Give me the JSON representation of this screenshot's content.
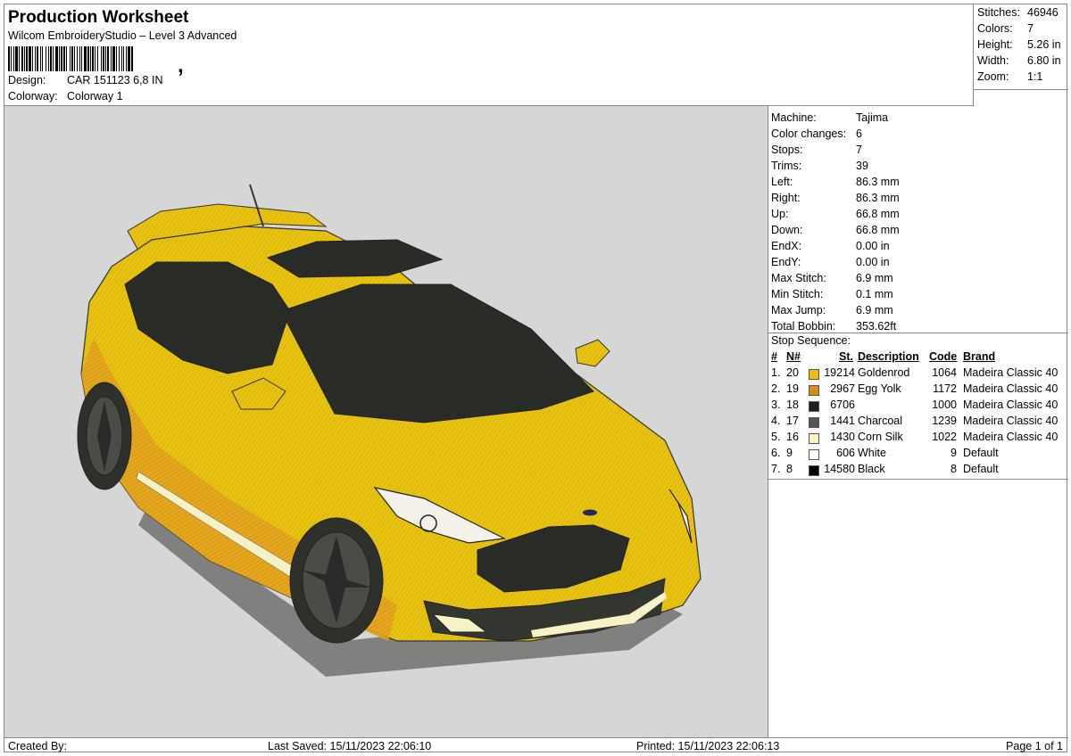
{
  "header": {
    "title": "Production Worksheet",
    "subtitle": "Wilcom EmbroideryStudio – Level 3 Advanced",
    "barcode_comma": ",",
    "design_label": "Design:",
    "design_value": "CAR 151123 6,8 IN",
    "colorway_label": "Colorway:",
    "colorway_value": "Colorway 1"
  },
  "stats": {
    "stitches_label": "Stitches:",
    "stitches_value": "46946",
    "colors_label": "Colors:",
    "colors_value": "7",
    "height_label": "Height:",
    "height_value": "5.26 in",
    "width_label": "Width:",
    "width_value": "6.80 in",
    "zoom_label": "Zoom:",
    "zoom_value": "1:1"
  },
  "machine_info": [
    {
      "label": "Machine:",
      "value": "Tajima"
    },
    {
      "label": "Color changes:",
      "value": "6"
    },
    {
      "label": "Stops:",
      "value": "7"
    },
    {
      "label": "Trims:",
      "value": "39"
    },
    {
      "label": "Left:",
      "value": "86.3 mm"
    },
    {
      "label": "Right:",
      "value": "86.3 mm"
    },
    {
      "label": "Up:",
      "value": "66.8 mm"
    },
    {
      "label": "Down:",
      "value": "66.8 mm"
    },
    {
      "label": "EndX:",
      "value": "0.00 in"
    },
    {
      "label": "EndY:",
      "value": "0.00 in"
    },
    {
      "label": "Max Stitch:",
      "value": "6.9 mm"
    },
    {
      "label": "Min Stitch:",
      "value": "0.1 mm"
    },
    {
      "label": "Max Jump:",
      "value": "6.9 mm"
    },
    {
      "label": "Total Bobbin:",
      "value": "353.62ft"
    }
  ],
  "stop_sequence": {
    "title": "Stop Sequence:",
    "headers": {
      "num": "#",
      "n": "N#",
      "st": "St.",
      "description": "Description",
      "code": "Code",
      "brand": "Brand"
    },
    "rows": [
      {
        "num": "1.",
        "n": "20",
        "color": "#f2bb0a",
        "st": "19214",
        "description": "Goldenrod",
        "code": "1064",
        "brand": "Madeira Classic 40"
      },
      {
        "num": "2.",
        "n": "19",
        "color": "#d98a12",
        "st": "2967",
        "description": "Egg Yolk",
        "code": "1172",
        "brand": "Madeira Classic 40"
      },
      {
        "num": "3.",
        "n": "18",
        "color": "#1e1e1e",
        "st": "6706",
        "description": "",
        "code": "1000",
        "brand": "Madeira Classic 40"
      },
      {
        "num": "4.",
        "n": "17",
        "color": "#555555",
        "st": "1441",
        "description": "Charcoal",
        "code": "1239",
        "brand": "Madeira Classic 40"
      },
      {
        "num": "5.",
        "n": "16",
        "color": "#fbf4c0",
        "st": "1430",
        "description": "Corn Silk",
        "code": "1022",
        "brand": "Madeira Classic 40"
      },
      {
        "num": "6.",
        "n": "9",
        "color": "#ffffff",
        "st": "606",
        "description": "White",
        "code": "9",
        "brand": "Default"
      },
      {
        "num": "7.",
        "n": "8",
        "color": "#000000",
        "st": "14580",
        "description": "Black",
        "code": "8",
        "brand": "Default"
      }
    ]
  },
  "footer": {
    "created_by": "Created By:",
    "last_saved": "Last Saved: 15/11/2023 22:06:10",
    "printed": "Printed: 15/11/2023 22:06:13",
    "page": "Page 1 of 1"
  }
}
